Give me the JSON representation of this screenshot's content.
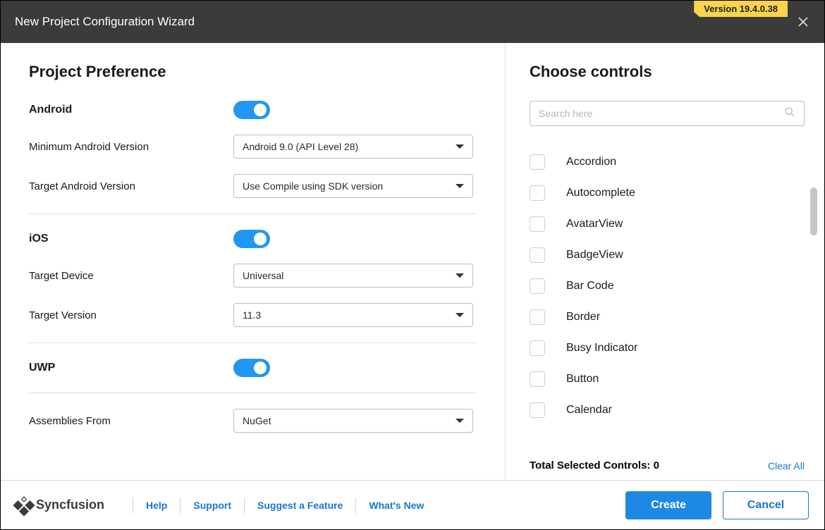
{
  "header": {
    "title": "New Project Configuration Wizard",
    "version": "Version 19.4.0.38"
  },
  "leftPanel": {
    "title": "Project Preference",
    "android": {
      "label": "Android",
      "minLabel": "Minimum Android Version",
      "minValue": "Android 9.0 (API Level 28)",
      "targetLabel": "Target Android Version",
      "targetValue": "Use Compile using SDK version"
    },
    "ios": {
      "label": "iOS",
      "deviceLabel": "Target Device",
      "deviceValue": "Universal",
      "versionLabel": "Target Version",
      "versionValue": "11.3"
    },
    "uwp": {
      "label": "UWP"
    },
    "assemblies": {
      "label": "Assemblies From",
      "value": "NuGet"
    }
  },
  "rightPanel": {
    "title": "Choose controls",
    "searchPlaceholder": "Search here",
    "controls": [
      "Accordion",
      "Autocomplete",
      "AvatarView",
      "BadgeView",
      "Bar Code",
      "Border",
      "Busy Indicator",
      "Button",
      "Calendar"
    ],
    "totalLabel": "Total Selected Controls: 0",
    "clearAll": "Clear All"
  },
  "footer": {
    "brand": "Syncfusion",
    "links": [
      "Help",
      "Support",
      "Suggest a Feature",
      "What's New"
    ],
    "create": "Create",
    "cancel": "Cancel"
  }
}
